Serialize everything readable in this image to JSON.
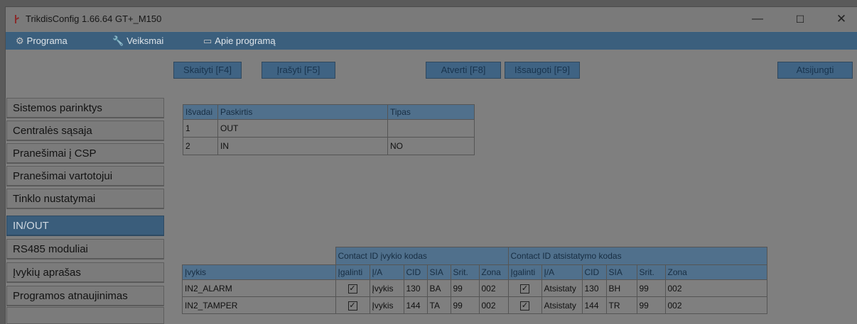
{
  "window": {
    "title": "TrikdisConfig 1.66.64   GT+_M150",
    "minimize": "—",
    "maximize": "☐",
    "close": "✕"
  },
  "menu": [
    {
      "label": "Programa",
      "icon": "gear-icon"
    },
    {
      "label": "Veiksmai",
      "icon": "wrench-icon"
    },
    {
      "label": "Apie programą",
      "icon": "info-window-icon"
    }
  ],
  "toolbar": {
    "read": "Skaityti [F4]",
    "write": "Įrašyti [F5]",
    "open": "Atverti [F8]",
    "save": "Išsaugoti [F9]",
    "disconnect": "Atsijungti"
  },
  "nav": [
    "Sistemos parinktys",
    "Centralės sąsaja",
    "Pranešimai į CSP",
    "Pranešimai vartotojui",
    "Tinklo nustatymai",
    "IN/OUT",
    "RS485 moduliai",
    "Įvykių aprašas",
    "Programos atnaujinimas"
  ],
  "nav_active": "IN/OUT",
  "outputs_table": {
    "headers": [
      "Išvadai",
      "Paskirtis",
      "Tipas"
    ],
    "rows": [
      [
        "1",
        "OUT",
        ""
      ],
      [
        "2",
        "IN",
        "NO"
      ]
    ]
  },
  "events_table": {
    "group_event": "Contact ID įvykio kodas",
    "group_restore": "Contact ID atsistatymo kodas",
    "headers": [
      "Įvykis",
      "Įgalinti",
      "Į/A",
      "CID",
      "SIA",
      "Srit.",
      "Zona",
      "Įgalinti",
      "Į/A",
      "CID",
      "SIA",
      "Srit.",
      "Zona"
    ],
    "rows": [
      {
        "name": "IN2_ALARM",
        "enable1": true,
        "ia1": "Įvykis",
        "cid1": "130",
        "sia1": "BA",
        "srit1": "99",
        "zona1": "002",
        "enable2": true,
        "ia2": "Atsistaty",
        "cid2": "130",
        "sia2": "BH",
        "srit2": "99",
        "zona2": "002"
      },
      {
        "name": "IN2_TAMPER",
        "enable1": true,
        "ia1": "Įvykis",
        "cid1": "144",
        "sia1": "TA",
        "srit1": "99",
        "zona1": "002",
        "enable2": true,
        "ia2": "Atsistaty",
        "cid2": "144",
        "sia2": "TR",
        "srit2": "99",
        "zona2": "002"
      }
    ]
  },
  "colors": {
    "accent": "#3b5f7d",
    "overlay_bg": "#7f7f7f"
  }
}
